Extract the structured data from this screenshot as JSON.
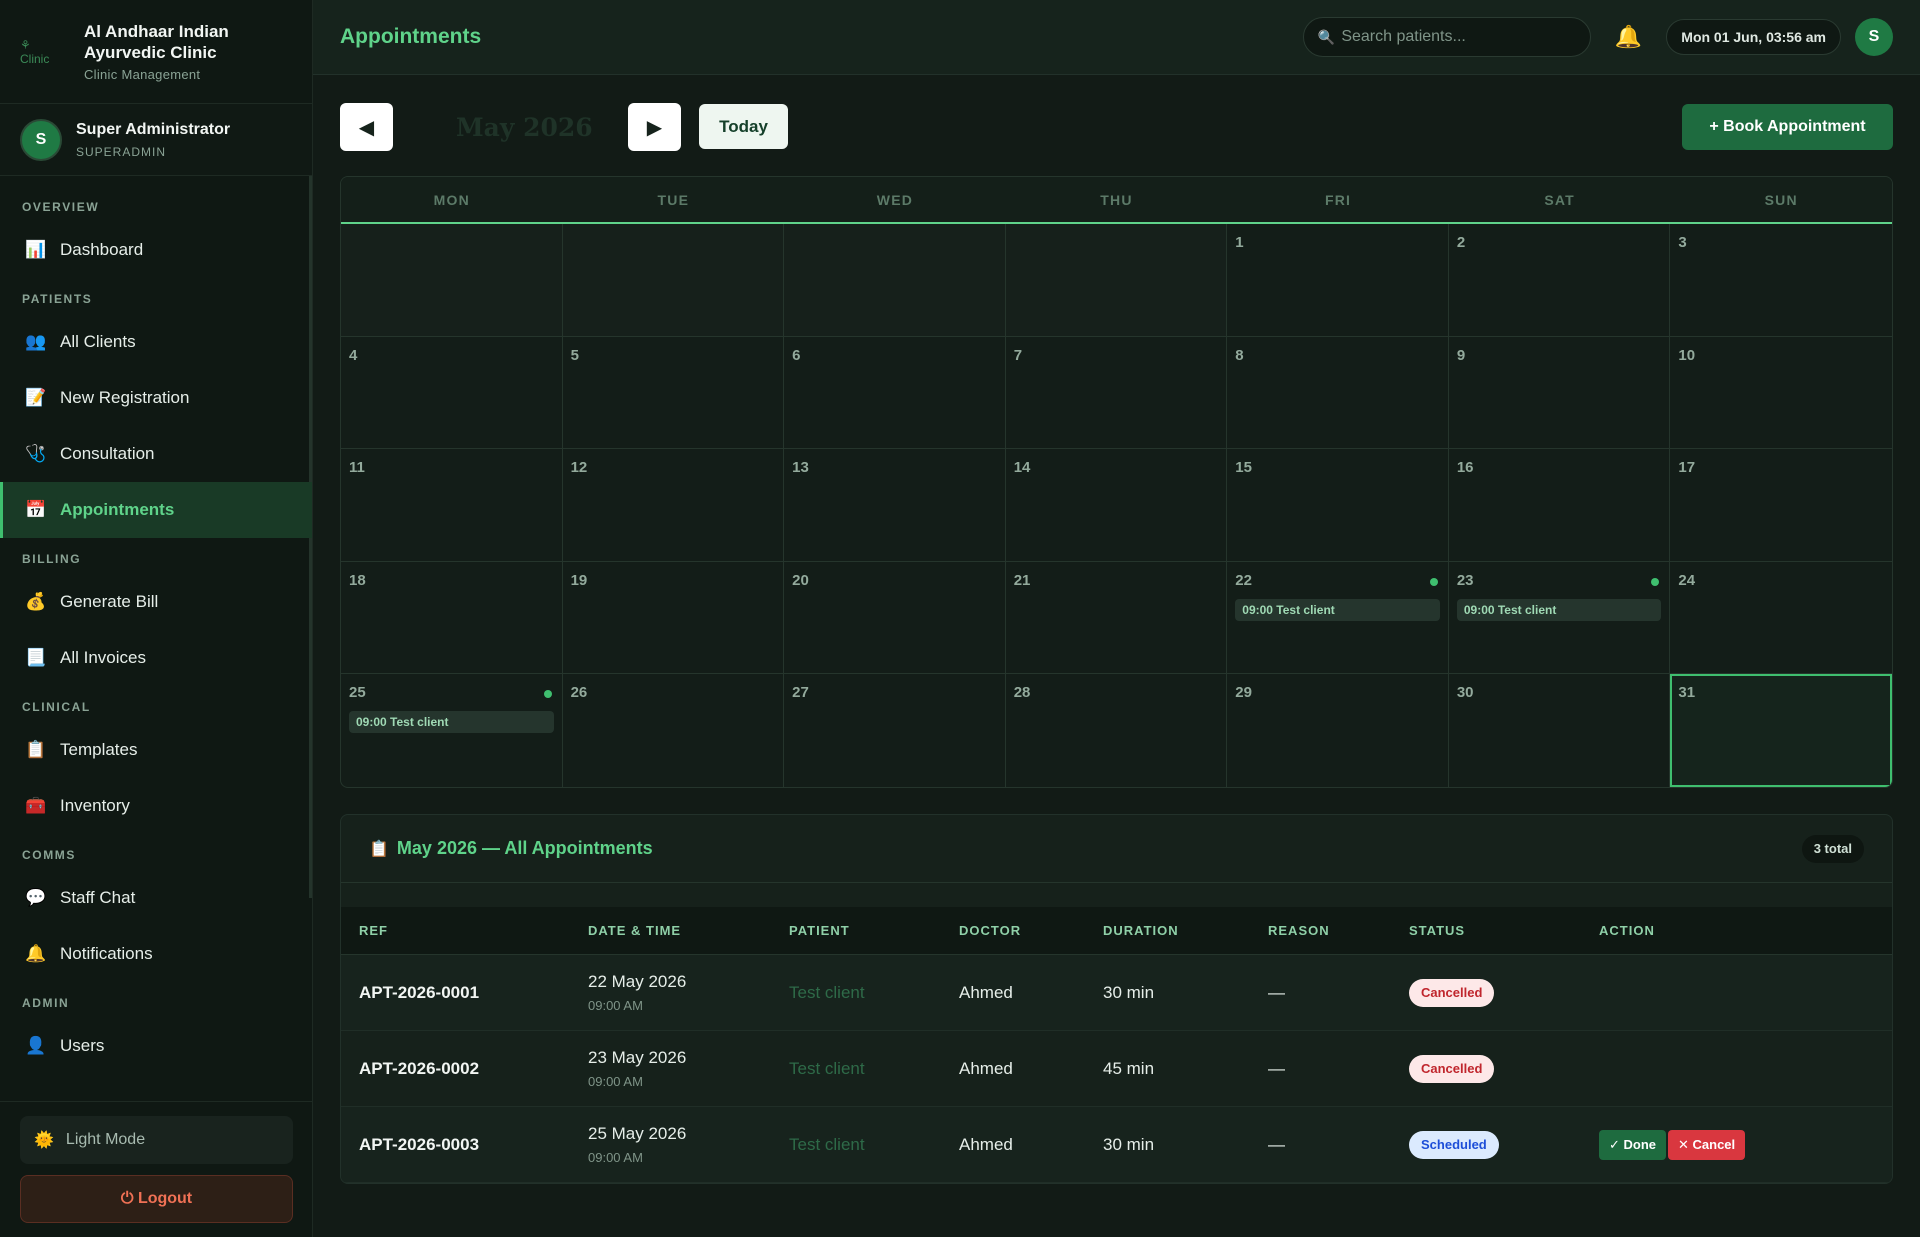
{
  "brand": {
    "logo_text": "⚘ Clinic",
    "name": "Al Andhaar Indian Ayurvedic Clinic",
    "subtitle": "Clinic Management"
  },
  "user": {
    "initial": "S",
    "name": "Super Administrator",
    "role": "SUPERADMIN"
  },
  "nav": {
    "sections": [
      {
        "title": "OVERVIEW",
        "items": [
          {
            "label": "Dashboard",
            "icon": "📊"
          }
        ]
      },
      {
        "title": "PATIENTS",
        "items": [
          {
            "label": "All Clients",
            "icon": "👥"
          },
          {
            "label": "New Registration",
            "icon": "📝"
          },
          {
            "label": "Consultation",
            "icon": "🩺"
          },
          {
            "label": "Appointments",
            "icon": "📅",
            "active": true
          }
        ]
      },
      {
        "title": "BILLING",
        "items": [
          {
            "label": "Generate Bill",
            "icon": "💰"
          },
          {
            "label": "All Invoices",
            "icon": "📃"
          }
        ]
      },
      {
        "title": "CLINICAL",
        "items": [
          {
            "label": "Templates",
            "icon": "📋"
          },
          {
            "label": "Inventory",
            "icon": "🧰"
          }
        ]
      },
      {
        "title": "COMMS",
        "items": [
          {
            "label": "Staff Chat",
            "icon": "💬"
          },
          {
            "label": "Notifications",
            "icon": "🔔"
          }
        ]
      },
      {
        "title": "ADMIN",
        "items": [
          {
            "label": "Users",
            "icon": "👤"
          }
        ]
      }
    ],
    "light_mode": "Light Mode",
    "logout": "⏻ Logout"
  },
  "header": {
    "title": "Appointments",
    "search_placeholder": "Search patients...",
    "datetime": "Mon 01 Jun, 03:56 am",
    "avatar": "S"
  },
  "toolbar": {
    "prev": "◀",
    "next": "▶",
    "month": "May 2026",
    "today": "Today",
    "book": "+  Book Appointment"
  },
  "calendar": {
    "weekdays": [
      "MON",
      "TUE",
      "WED",
      "THU",
      "FRI",
      "SAT",
      "SUN"
    ],
    "cells": [
      {
        "day": ""
      },
      {
        "day": ""
      },
      {
        "day": ""
      },
      {
        "day": ""
      },
      {
        "day": "1"
      },
      {
        "day": "2"
      },
      {
        "day": "3"
      },
      {
        "day": "4"
      },
      {
        "day": "5"
      },
      {
        "day": "6"
      },
      {
        "day": "7"
      },
      {
        "day": "8"
      },
      {
        "day": "9"
      },
      {
        "day": "10"
      },
      {
        "day": "11"
      },
      {
        "day": "12"
      },
      {
        "day": "13"
      },
      {
        "day": "14"
      },
      {
        "day": "15"
      },
      {
        "day": "16"
      },
      {
        "day": "17"
      },
      {
        "day": "18"
      },
      {
        "day": "19"
      },
      {
        "day": "20"
      },
      {
        "day": "21"
      },
      {
        "day": "22",
        "event": "09:00 Test client"
      },
      {
        "day": "23",
        "event": "09:00 Test client"
      },
      {
        "day": "24"
      },
      {
        "day": "25",
        "event": "09:00 Test client"
      },
      {
        "day": "26"
      },
      {
        "day": "27"
      },
      {
        "day": "28"
      },
      {
        "day": "29"
      },
      {
        "day": "30"
      },
      {
        "day": "31",
        "today": true
      }
    ]
  },
  "panel": {
    "icon": "📋",
    "title": "May 2026 — All Appointments",
    "total": "3 total",
    "columns": [
      "REF",
      "DATE & TIME",
      "PATIENT",
      "DOCTOR",
      "DURATION",
      "REASON",
      "STATUS",
      "ACTION"
    ],
    "rows": [
      {
        "ref": "APT-2026-0001",
        "date": "22 May 2026",
        "time": "09:00 AM",
        "patient": "Test client",
        "doctor": "Ahmed",
        "duration": "30 min",
        "reason": "—",
        "status": "Cancelled",
        "actions": []
      },
      {
        "ref": "APT-2026-0002",
        "date": "23 May 2026",
        "time": "09:00 AM",
        "patient": "Test client",
        "doctor": "Ahmed",
        "duration": "45 min",
        "reason": "—",
        "status": "Cancelled",
        "actions": []
      },
      {
        "ref": "APT-2026-0003",
        "date": "25 May 2026",
        "time": "09:00 AM",
        "patient": "Test client",
        "doctor": "Ahmed",
        "duration": "30 min",
        "reason": "—",
        "status": "Scheduled",
        "actions": [
          "✓ Done",
          "✕ Cancel"
        ]
      }
    ]
  },
  "colors": {
    "accent": "#5fd38a",
    "primary_button": "#1e6b3f",
    "danger": "#d9373f",
    "background": "#121b16"
  }
}
